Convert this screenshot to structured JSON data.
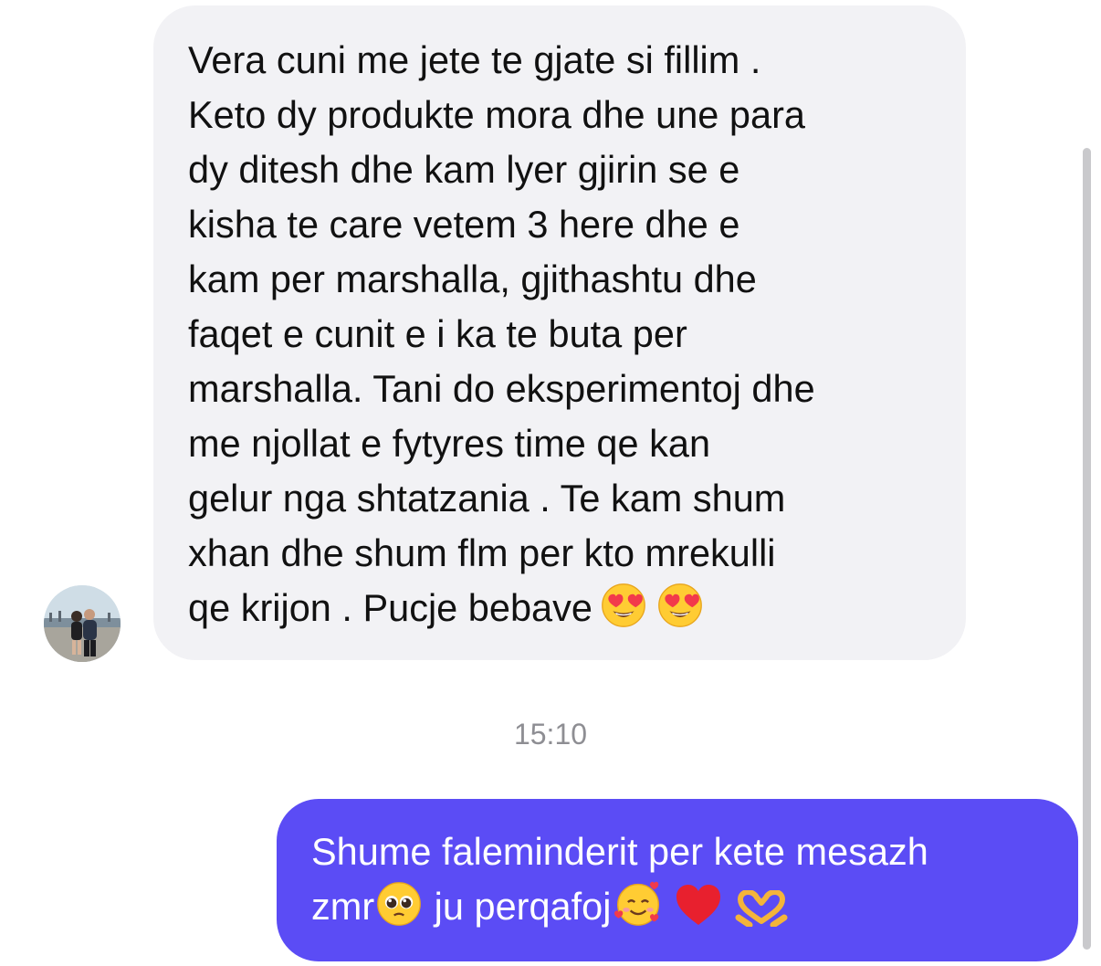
{
  "conversation": {
    "incoming": {
      "text": "Vera cuni me jete te gjate si fillim .\nKeto dy produkte mora dhe une para\ndy ditesh dhe kam lyer gjirin se e\nkisha te care vetem 3 here dhe e\nkam per marshalla, gjithashtu dhe\nfaqet e cunit e i ka te buta per\nmarshalla. Tani do eksperimentoj dhe\nme njollat e fytyres time qe kan\ngelur nga shtatzania . Te kam shum\nxhan dhe shum flm per kto mrekulli\nqe krijon . Pucje bebave",
      "emojis": [
        "heart-eyes-emoji",
        "heart-eyes-emoji"
      ],
      "bubble_color": "#f2f2f5"
    },
    "timestamp": "15:10",
    "outgoing": {
      "line1": "Shume faleminderit per kete mesazh",
      "line2_part1": "zmr",
      "line2_part2": " ju perqafoj",
      "emojis": [
        "pleading-face-emoji",
        "smiling-face-with-hearts-emoji",
        "red-heart-emoji",
        "heart-hands-emoji"
      ],
      "bubble_color": "#5b4cf5"
    }
  },
  "colors": {
    "accent": "#5b4cf5",
    "timestamp": "#8e8e93"
  }
}
